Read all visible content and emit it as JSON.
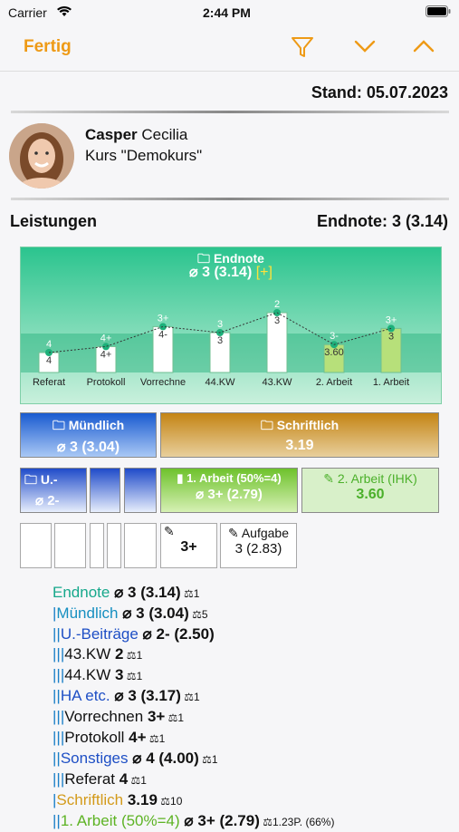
{
  "status": {
    "carrier": "Carrier",
    "time": "2:44 PM"
  },
  "nav": {
    "done": "Fertig"
  },
  "header": {
    "stand": "Stand: 05.07.2023",
    "last_name": "Casper",
    "first_name": "Cecilia",
    "course": "Kurs \"Demokurs\""
  },
  "section": {
    "title": "Leistungen",
    "final": "Endnote: 3 (3.14)"
  },
  "chart": {
    "title": "Endnote",
    "value": "⌀ 3 (3.14)",
    "bracket": "[+]",
    "items": [
      {
        "label": "Referat",
        "grade": "4",
        "score": 4.0,
        "above": "4",
        "below": "4"
      },
      {
        "label": "Protokoll",
        "grade": "4+",
        "score": 3.7,
        "above": "4+",
        "below": "4+"
      },
      {
        "label": "Vorrechne",
        "grade": "3+",
        "score": 2.7,
        "above": "3+",
        "below": "4-"
      },
      {
        "label": "44.KW",
        "grade": "3",
        "score": 3.0,
        "above": "3",
        "below": "3"
      },
      {
        "label": "43.KW",
        "grade": "2",
        "score": 2.0,
        "above": "2",
        "below": "3"
      },
      {
        "label": "2. Arbeit",
        "grade": "3.60",
        "score": 3.6,
        "above": "3-",
        "below": "3.60"
      },
      {
        "label": "1. Arbeit",
        "grade": "3+",
        "score": 2.79,
        "above": "3+",
        "below": "3"
      }
    ]
  },
  "tiles": {
    "muendlich": {
      "title": "Mündlich",
      "value": "⌀ 3 (3.04)"
    },
    "schriftlich": {
      "title": "Schriftlich",
      "value": "3.19"
    },
    "ub": {
      "title": "U.-",
      "value": "⌀ 2-"
    },
    "arbeit1": {
      "title": "1. Arbeit (50%=4)",
      "value": "⌀ 3+ (2.79)"
    },
    "arbeit2": {
      "title": "2. Arbeit (IHK)",
      "value": "3.60"
    },
    "t1": {
      "value": "3+"
    },
    "aufgabe": {
      "title": "Aufgabe",
      "value": "3 (2.83)"
    }
  },
  "list": [
    {
      "bars": "",
      "name": "Endnote",
      "grade": "⌀ 3 (3.14)",
      "count": "1"
    },
    {
      "bars": "|",
      "name": "Mündlich",
      "grade": "⌀ 3 (3.04)",
      "count": "5"
    },
    {
      "bars": "||",
      "name": "U.-Beiträge",
      "grade": "⌀ 2- (2.50)",
      "count": ""
    },
    {
      "bars": "|||",
      "name": "43.KW",
      "grade": "2",
      "count": "1"
    },
    {
      "bars": "|||",
      "name": "44.KW",
      "grade": "3",
      "count": "1"
    },
    {
      "bars": "||",
      "name": "HA etc.",
      "grade": "⌀ 3 (3.17)",
      "count": "1"
    },
    {
      "bars": "|||",
      "name": "Vorrechnen",
      "grade": "3+",
      "count": "1"
    },
    {
      "bars": "|||",
      "name": "Protokoll",
      "grade": "4+",
      "count": "1"
    },
    {
      "bars": "||",
      "name": "Sonstiges",
      "grade": "⌀ 4 (4.00)",
      "count": "1"
    },
    {
      "bars": "|||",
      "name": "Referat",
      "grade": "4",
      "count": "1"
    },
    {
      "bars": "|",
      "name": "Schriftlich",
      "grade": "3.19",
      "count": "10"
    },
    {
      "bars": "||",
      "name": "1. Arbeit (50%=4)",
      "grade": "⌀ 3+ (2.79)",
      "count": "1.23P. (66%)"
    }
  ],
  "colors": {
    "accent": "#ee9a16",
    "chart": "#2bc48e"
  }
}
